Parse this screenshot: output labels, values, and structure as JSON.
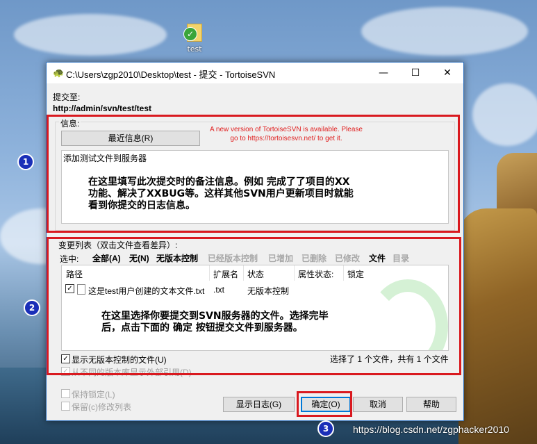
{
  "desktop": {
    "icon_label": "test"
  },
  "window": {
    "title": "C:\\Users\\zgp2010\\Desktop\\test - 提交 - TortoiseSVN",
    "minimize": "—",
    "maximize": "☐",
    "close": "✕"
  },
  "commit_to": {
    "label": "提交至:",
    "url": "http://admin/svn/test/test"
  },
  "message": {
    "group_label": "信息:",
    "recent_button": "最近信息(R)",
    "update_notice": "A new version of TortoiseSVN is available. Please go to https://tortoisesvn.net/ to get it.",
    "text": "添加测试文件到服务器",
    "annotation": "在这里填写此次提交时的备注信息。例如 完成了了项目的XX\n功能、解决了XXBUG等。这样其他SVN用户更新项目时就能\n看到你提交的日志信息。"
  },
  "changes": {
    "group_label": "变更列表（双击文件查看差异）:",
    "select_label": "选中:",
    "filters": [
      {
        "label": "全部(A)",
        "enabled": true
      },
      {
        "label": "无(N)",
        "enabled": true
      },
      {
        "label": "无版本控制",
        "enabled": true
      },
      {
        "label": "已经版本控制",
        "enabled": false
      },
      {
        "label": "已增加",
        "enabled": false
      },
      {
        "label": "已删除",
        "enabled": false
      },
      {
        "label": "已修改",
        "enabled": false
      },
      {
        "label": "文件",
        "enabled": true
      },
      {
        "label": "目录",
        "enabled": false
      }
    ],
    "columns": [
      "路径",
      "扩展名",
      "状态",
      "属性状态:",
      "锁定"
    ],
    "rows": [
      {
        "checked": true,
        "path": "这是test用户创建的文本文件.txt",
        "ext": ".txt",
        "status": "无版本控制"
      }
    ],
    "annotation": "在这里选择你要提交到SVN服务器的文件。选择完毕\n后，点击下面的 确定 按钮提交文件到服务器。",
    "show_unversioned": "显示无版本控制的文件(U)",
    "show_externals": "从不同的版本库显示外部引用(D)",
    "summary": "选择了 1 个文件，共有 1 个文件"
  },
  "options": {
    "keep_locks": "保持锁定(L)",
    "keep_changelists": "保留(c)修改列表"
  },
  "buttons": {
    "show_log": "显示日志(G)",
    "ok": "确定(O)",
    "cancel": "取消",
    "help": "帮助"
  },
  "markers": [
    "1",
    "2",
    "3"
  ],
  "watermark": "https://blog.csdn.net/zgphacker2010"
}
